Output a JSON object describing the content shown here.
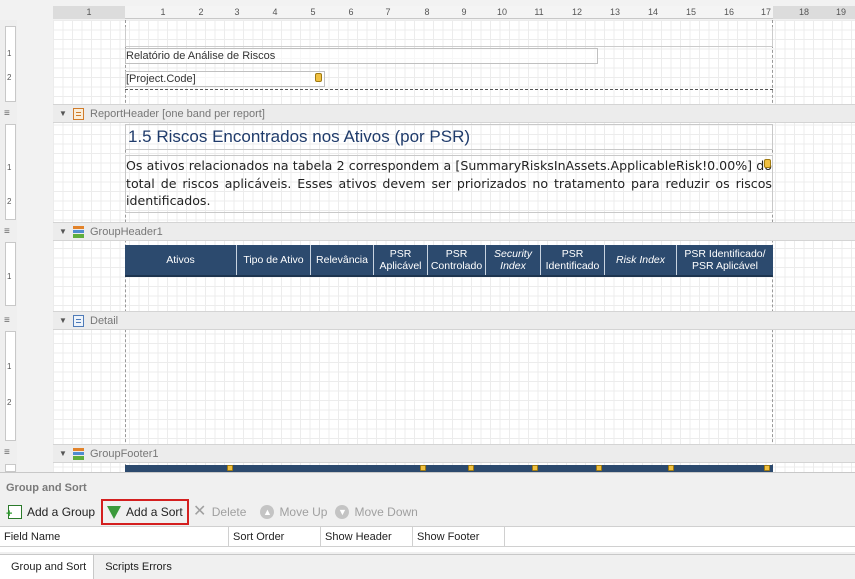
{
  "ruler": {
    "ticks": [
      "1",
      "1",
      "2",
      "3",
      "4",
      "5",
      "6",
      "7",
      "8",
      "9",
      "10",
      "11",
      "12",
      "13",
      "14",
      "15",
      "16",
      "17",
      "18",
      "19"
    ]
  },
  "vruler": {
    "top": [
      "1",
      "2"
    ],
    "report_header": [
      "1",
      "2"
    ],
    "group_header": [
      "1"
    ],
    "detail": [
      "1",
      "2"
    ]
  },
  "page_header": {
    "title_field": "Relatório de Análise de Riscos",
    "project_field": "[Project.Code]"
  },
  "bands": {
    "report_header": "ReportHeader [one band per report]",
    "group_header": "GroupHeader1",
    "detail": "Detail",
    "group_footer": "GroupFooter1"
  },
  "report_header": {
    "title": "1.5 Riscos Encontrados nos Ativos (por PSR)",
    "paragraph": "Os ativos relacionados na tabela 2 correspondem a [SummaryRisksInAssets.ApplicableRisk!0.00%] do total de riscos aplicáveis. Esses ativos devem ser priorizados no tratamento para reduzir os riscos identificados."
  },
  "table_header": [
    {
      "label": "Ativos",
      "italic": false
    },
    {
      "label": "Tipo de Ativo",
      "italic": false
    },
    {
      "label": "Relevância",
      "italic": false
    },
    {
      "label": "PSR Aplicável",
      "italic": false
    },
    {
      "label": "PSR Controlado",
      "italic": false
    },
    {
      "label": "Security Index",
      "italic": true
    },
    {
      "label": "PSR Identificado",
      "italic": false
    },
    {
      "label": "Risk Index",
      "italic": true
    },
    {
      "label": "PSR Identificado/ PSR Aplicável",
      "italic": false
    }
  ],
  "group_sort_panel": {
    "title": "Group and Sort",
    "toolbar": {
      "add_group": "Add a Group",
      "add_sort": "Add a Sort",
      "delete": "Delete",
      "move_up": "Move Up",
      "move_down": "Move Down"
    },
    "columns": [
      "Field Name",
      "Sort Order",
      "Show Header",
      "Show Footer"
    ]
  },
  "tabs": [
    "Group and Sort",
    "Scripts Errors"
  ],
  "colors": {
    "table_header_bg": "#2c4a6e",
    "title_text": "#1f3b6b",
    "highlight": "#d41f1f"
  }
}
